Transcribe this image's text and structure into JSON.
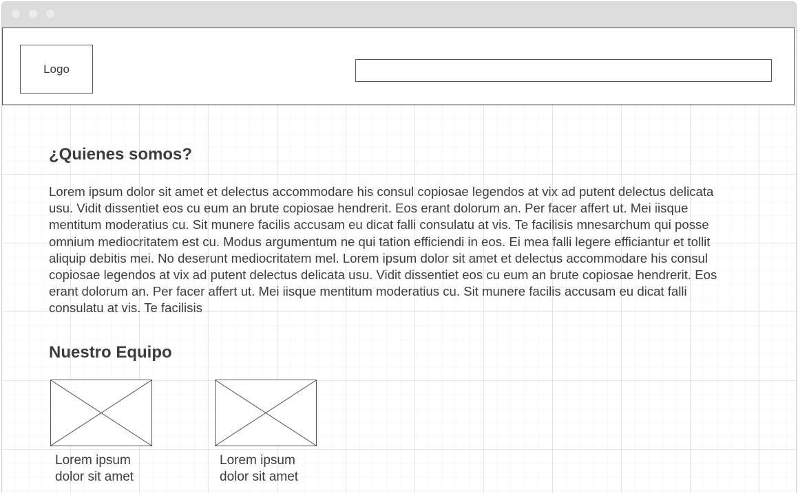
{
  "header": {
    "logo_label": "Logo",
    "search": {
      "value": "",
      "placeholder": ""
    }
  },
  "about": {
    "title": "¿Quienes somos?",
    "body": "Lorem ipsum dolor sit amet et delectus accommodare his consul copiosae legendos at vix ad putent delectus delicata usu. Vidit dissentiet eos cu eum an brute copiosae hendrerit. Eos erant dolorum an. Per facer affert ut. Mei iisque mentitum moderatius cu. Sit munere facilis accusam eu dicat falli consulatu at vis. Te facilisis mnesarchum qui posse omnium mediocritatem est cu. Modus argumentum ne qui tation efficiendi in eos. Ei mea falli legere efficiantur et tollit aliquip debitis mei. No deserunt mediocritatem mel. Lorem ipsum dolor sit amet et delectus accommodare his consul copiosae legendos at vix ad putent delectus delicata usu. Vidit dissentiet eos cu eum an brute copiosae hendrerit. Eos erant dolorum an. Per facer affert ut. Mei iisque mentitum moderatius cu. Sit munere facilis accusam eu dicat falli consulatu at vis. Te facilisis"
  },
  "team": {
    "title": "Nuestro Equipo",
    "members": [
      {
        "caption": "Lorem ipsum dolor sit amet",
        "icon": "image-placeholder-icon"
      },
      {
        "caption": "Lorem ipsum dolor sit amet",
        "icon": "image-placeholder-icon"
      }
    ]
  }
}
